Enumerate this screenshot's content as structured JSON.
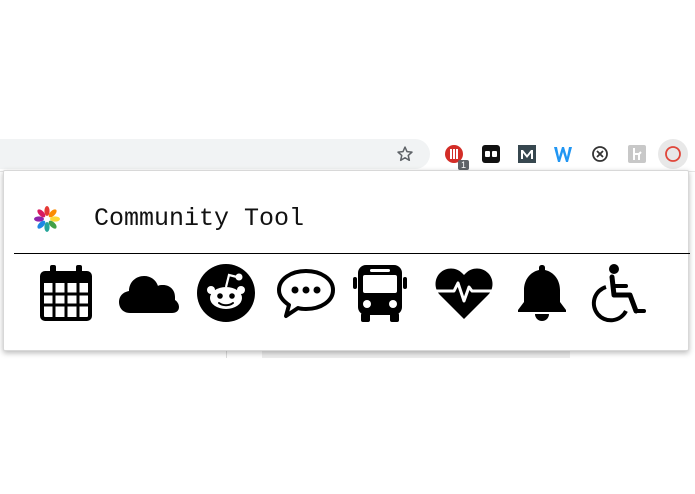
{
  "browser": {
    "extensions": [
      {
        "name": "lastpass",
        "badge": "1"
      },
      {
        "name": "tab-manager"
      },
      {
        "name": "mailtrack"
      },
      {
        "name": "wappalyzer"
      },
      {
        "name": "clear-cache"
      },
      {
        "name": "hiveage"
      },
      {
        "name": "community-tool",
        "active": true
      }
    ]
  },
  "popup": {
    "title": "Community Tool",
    "icons": [
      "calendar-icon",
      "cloud-icon",
      "reddit-icon",
      "chat-icon",
      "bus-icon",
      "heartbeat-icon",
      "bell-icon",
      "wheelchair-icon"
    ]
  },
  "colors": {
    "lastpass_red": "#d32d27",
    "ext_active_ring": "#e0463a",
    "icon_color": "#000000"
  }
}
